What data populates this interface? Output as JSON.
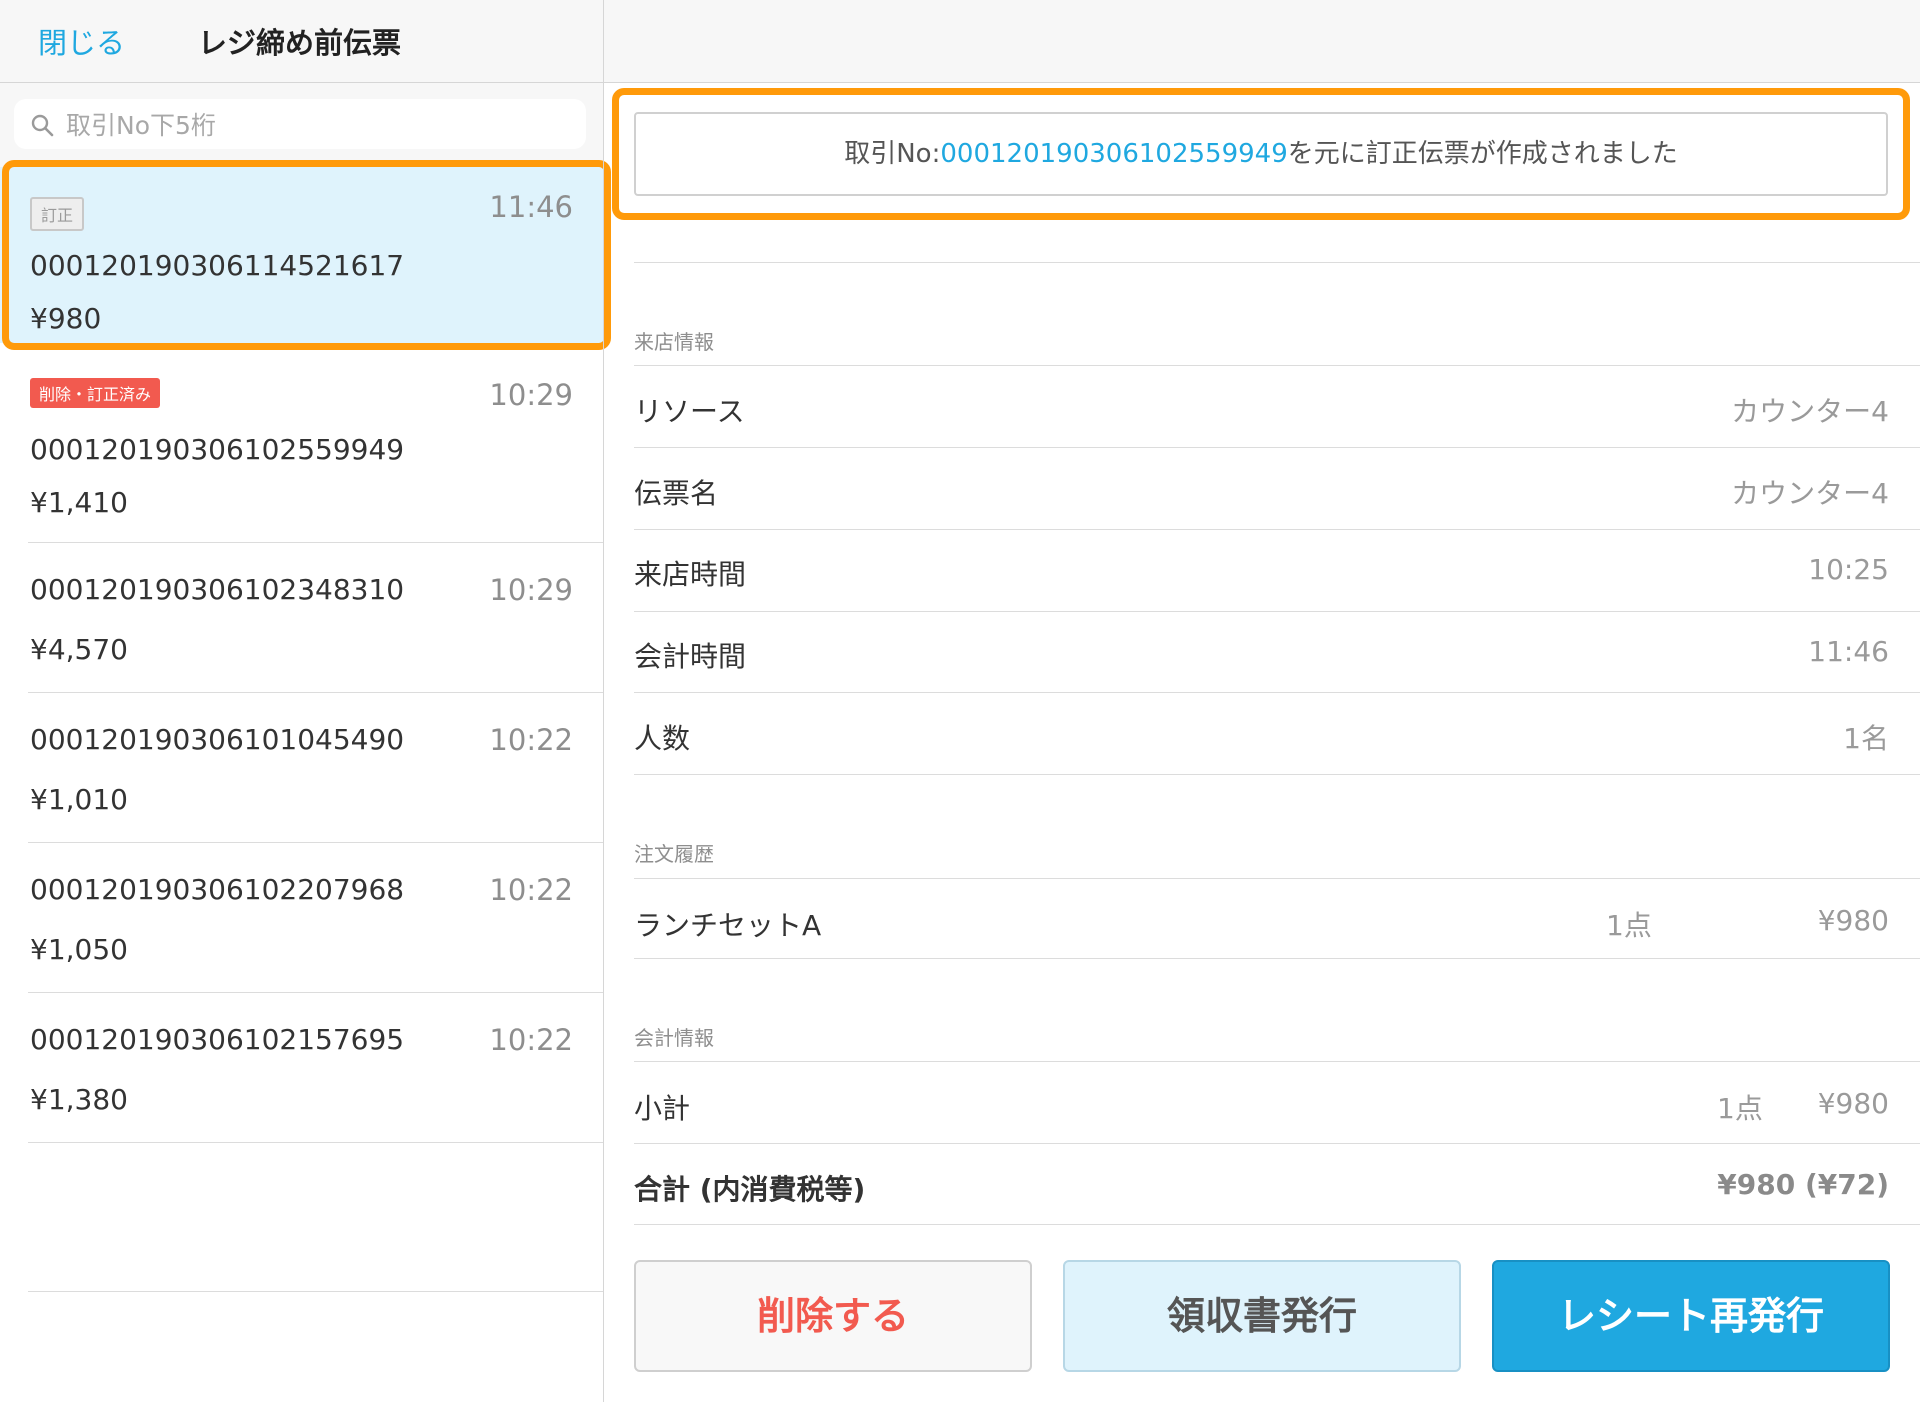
{
  "header": {
    "close_label": "閉じる",
    "title": "レジ締め前伝票"
  },
  "search": {
    "placeholder": "取引No下5桁"
  },
  "transactions": [
    {
      "badge": "訂正",
      "time": "11:46",
      "number": "000120190306114521617",
      "price": "¥980"
    },
    {
      "badge": "削除・訂正済み",
      "time": "10:29",
      "number": "000120190306102559949",
      "price": "¥1,410"
    },
    {
      "badge": "",
      "time": "10:29",
      "number": "000120190306102348310",
      "price": "¥4,570"
    },
    {
      "badge": "",
      "time": "10:22",
      "number": "000120190306101045490",
      "price": "¥1,010"
    },
    {
      "badge": "",
      "time": "10:22",
      "number": "000120190306102207968",
      "price": "¥1,050"
    },
    {
      "badge": "",
      "time": "10:22",
      "number": "000120190306102157695",
      "price": "¥1,380"
    }
  ],
  "notice": {
    "prefix": "取引No:",
    "number": "000120190306102559949",
    "suffix": "を元に訂正伝票が作成されました"
  },
  "visit_info": {
    "section": "来店情報",
    "rows": [
      {
        "label": "リソース",
        "value": "カウンター4"
      },
      {
        "label": "伝票名",
        "value": "カウンター4"
      },
      {
        "label": "来店時間",
        "value": "10:25"
      },
      {
        "label": "会計時間",
        "value": "11:46"
      },
      {
        "label": "人数",
        "value": "1名"
      }
    ]
  },
  "order_history": {
    "section": "注文履歴",
    "items": [
      {
        "name": "ランチセットA",
        "qty": "1点",
        "price": "¥980"
      }
    ]
  },
  "payment_info": {
    "section": "会計情報",
    "subtotal_label": "小計",
    "subtotal_qty": "1点",
    "subtotal_value": "¥980",
    "total_label": "合計 (内消費税等)",
    "total_value": "¥980 (¥72)"
  },
  "buttons": {
    "delete": "削除する",
    "receipt": "領収書発行",
    "reissue": "レシート再発行"
  },
  "colors": {
    "accent": "#1fa8e0",
    "highlight": "#ff9a0a",
    "danger": "#f25a4f",
    "selected_bg": "#dff3fc"
  }
}
